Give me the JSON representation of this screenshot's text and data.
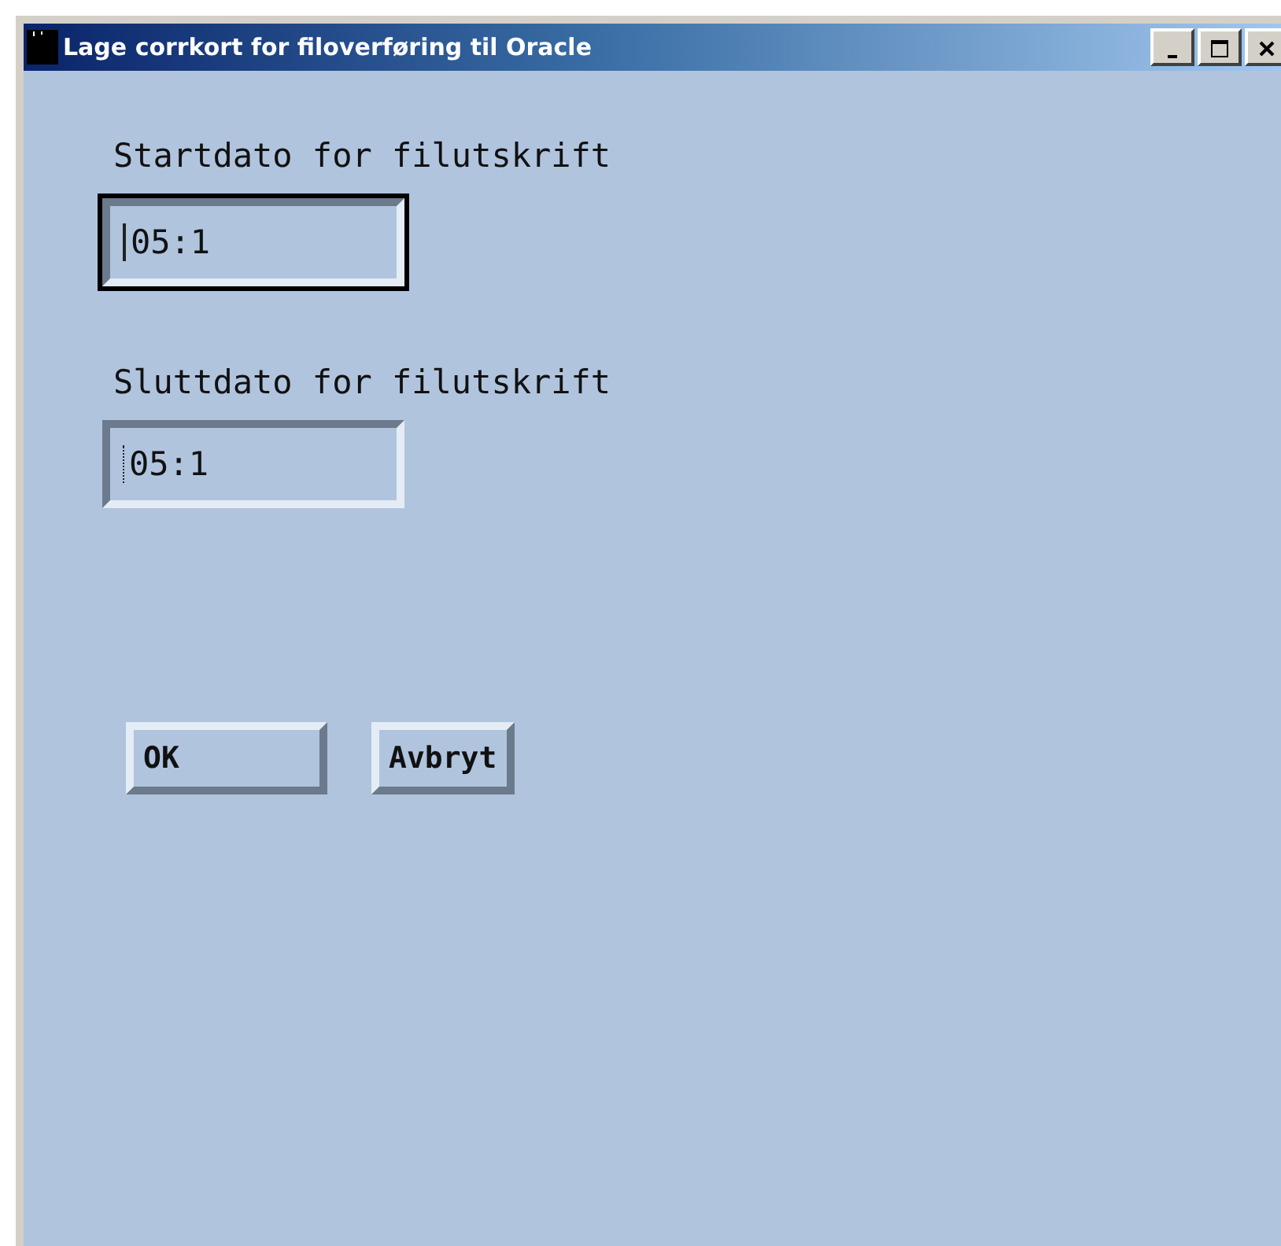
{
  "window": {
    "title": "Lage corrkort for filoverføring til Oracle"
  },
  "fields": [
    {
      "label": "Startdato for filutskrift",
      "value": "05:1",
      "focused": true
    },
    {
      "label": "Sluttdato for filutskrift",
      "value": "05:1",
      "focused": false
    }
  ],
  "buttons": [
    "OK",
    "Avbryt"
  ]
}
